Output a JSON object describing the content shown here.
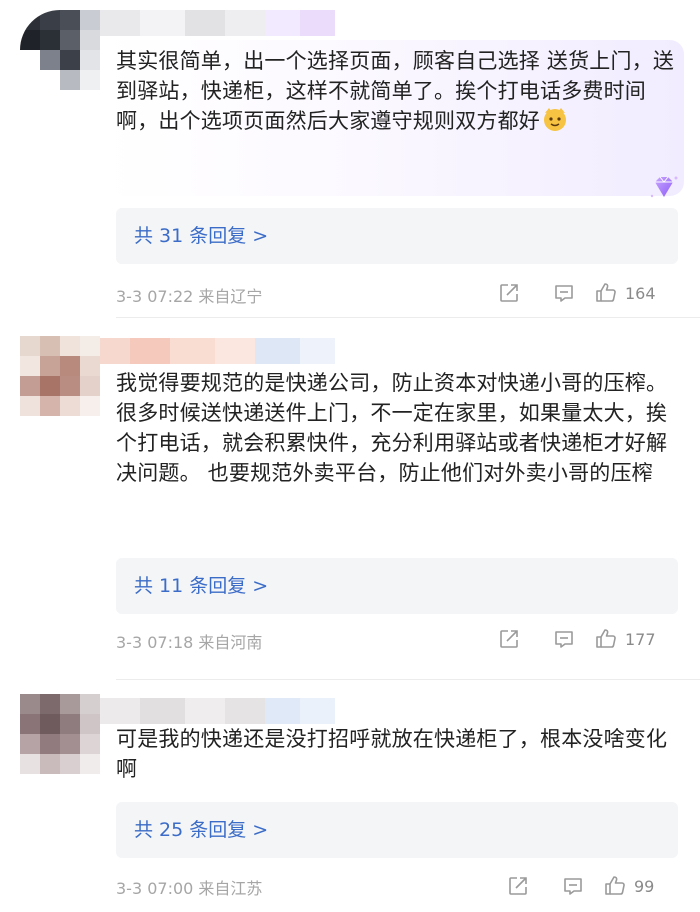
{
  "comments": [
    {
      "text": "其实很简单，出一个选择页面，顾客自己选择 送货上门，送到驿站，快递柜，这样不就简单了。挨个打电话多费时间啊，出个选项页面然后大家遵守规则双方都好",
      "emoji_icon": "cat-face-emoji-icon",
      "replies": "共 31 条回复 >",
      "date": "3-3 07:22",
      "location": "来自辽宁",
      "likes": "164"
    },
    {
      "text": "我觉得要规范的是快递公司，防止资本对快递小哥的压榨。很多时候送快递送件上门，不一定在家里，如果量太大，挨个打电话，就会积累快件，充分利用驿站或者快递柜才好解决问题。 也要规范外卖平台，防止他们对外卖小哥的压榨",
      "replies": "共 11 条回复 >",
      "date": "3-3 07:18",
      "location": "来自河南",
      "likes": "177"
    },
    {
      "text": "可是我的快递还是没打招呼就放在快递柜了，根本没啥变化啊",
      "replies": "共 25 条回复 >",
      "date": "3-3 07:00",
      "location": "来自江苏",
      "likes": "99"
    }
  ],
  "icons": {
    "share": "share-icon",
    "comment": "comment-icon",
    "like": "thumbs-up-icon",
    "badge": "diamond-badge-icon"
  },
  "colors": {
    "reply_link": "#3b6cc7",
    "meta_text": "#a6a6a6",
    "reply_bg": "#f4f5f7"
  }
}
